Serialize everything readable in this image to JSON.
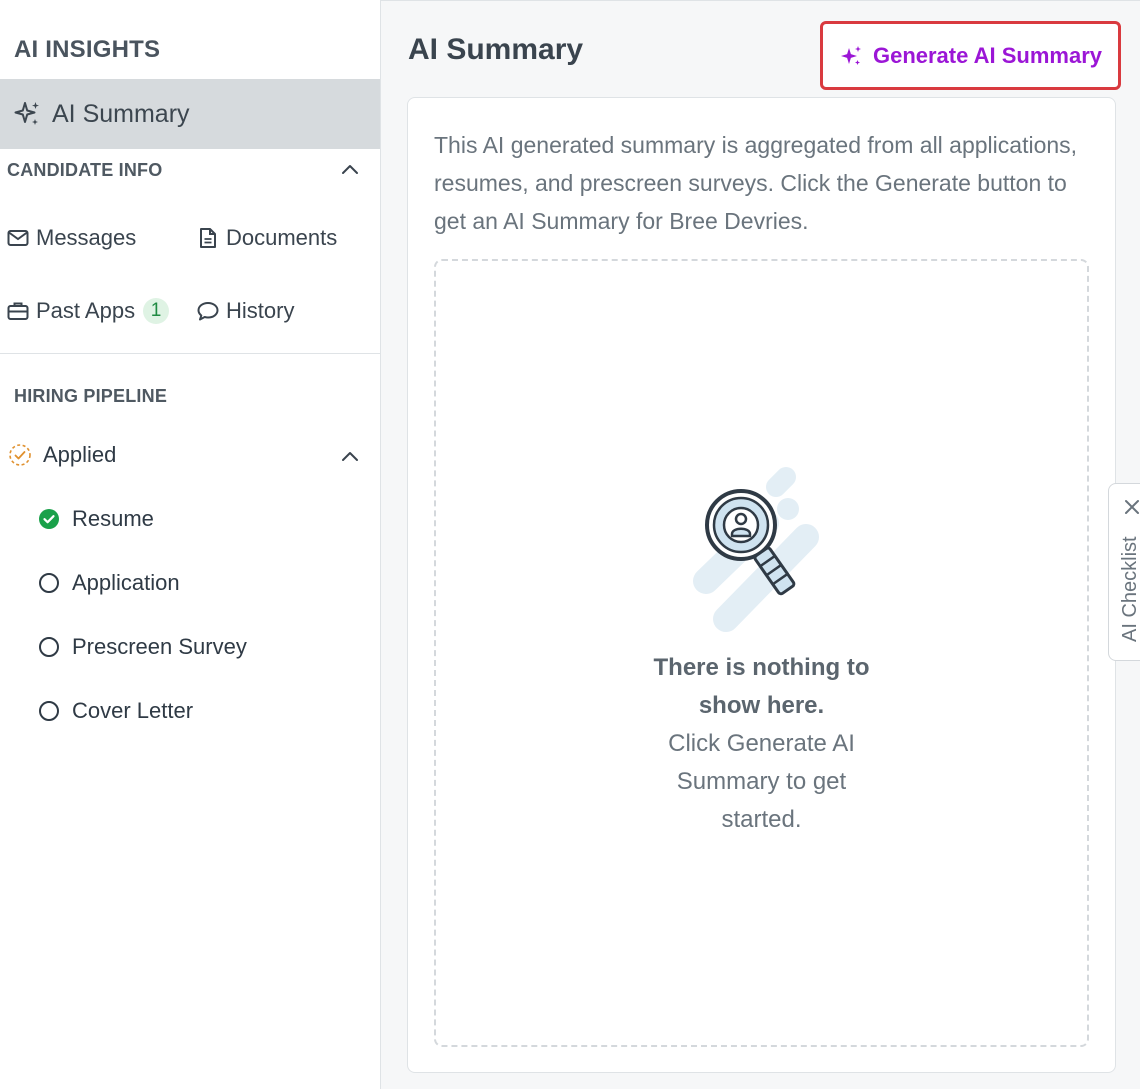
{
  "sidebar": {
    "title": "AI INSIGHTS",
    "active_item": {
      "label": "AI Summary",
      "icon": "sparkle-icon"
    },
    "candidate_info": {
      "heading": "CANDIDATE INFO",
      "links": {
        "messages": {
          "label": "Messages",
          "icon": "envelope-icon"
        },
        "documents": {
          "label": "Documents",
          "icon": "document-icon"
        },
        "past_apps": {
          "label": "Past Apps",
          "icon": "briefcase-icon",
          "badge": "1"
        },
        "history": {
          "label": "History",
          "icon": "speech-bubble-icon"
        }
      }
    },
    "hiring_pipeline": {
      "heading": "HIRING PIPELINE",
      "stage": {
        "label": "Applied",
        "icon": "dashed-check-circle-icon"
      },
      "steps": [
        {
          "label": "Resume",
          "status": "complete"
        },
        {
          "label": "Application",
          "status": "incomplete"
        },
        {
          "label": "Prescreen Survey",
          "status": "incomplete"
        },
        {
          "label": "Cover Letter",
          "status": "incomplete"
        }
      ]
    }
  },
  "main": {
    "title": "AI Summary",
    "generate_button": {
      "label": "Generate AI Summary",
      "icon": "sparkle-icon"
    },
    "description": "This AI generated summary is aggregated from all applications, resumes, and prescreen surveys. Click the Generate button to get an AI Summary for Bree Devries.",
    "empty_state": {
      "title": "There is nothing to show here.",
      "subtitle": "Click Generate AI Summary to get started."
    },
    "side_tab": {
      "label": "AI Checklist"
    }
  },
  "colors": {
    "accent_purple": "#9b16d6",
    "highlight_red": "#d93a3f",
    "success_green": "#1aa14a",
    "warning_orange": "#e0912f",
    "active_bg": "#d6dadd"
  }
}
